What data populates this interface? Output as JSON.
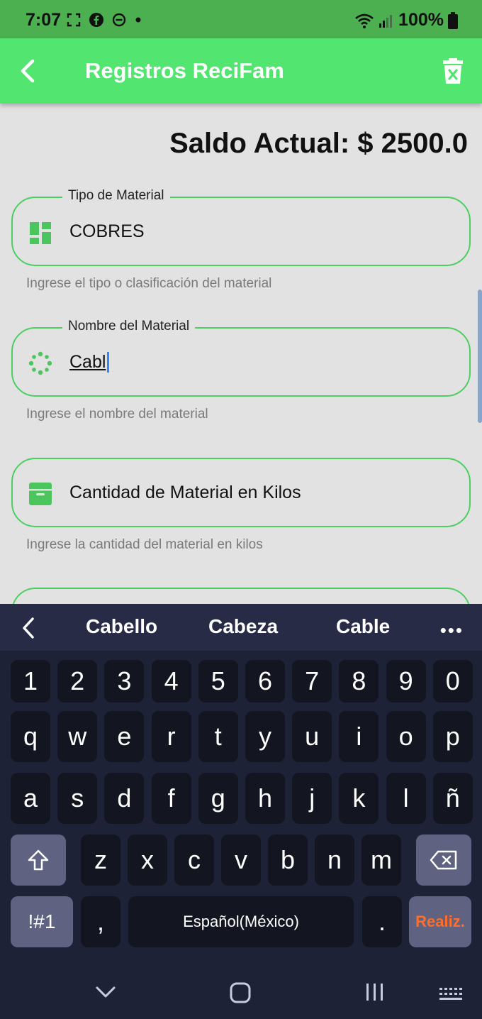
{
  "status_bar": {
    "time": "7:07",
    "battery": "100%",
    "icons": [
      "screenshot-icon",
      "facebook-icon",
      "dnd-icon",
      "dot-icon",
      "wifi-icon",
      "signal-icon",
      "battery-icon"
    ]
  },
  "app_bar": {
    "title": "Registros ReciFam",
    "back_icon": "arrow-back-icon",
    "action_icon": "delete-icon"
  },
  "balance": "Saldo Actual: $ 2500.0",
  "fields": [
    {
      "label": "Tipo de Material",
      "value": "COBRES",
      "placeholder": "",
      "helper": "Ingrese el tipo o clasificación del material",
      "icon": "dashboard-icon"
    },
    {
      "label": "Nombre del Material",
      "value": "Cabl",
      "placeholder": "",
      "helper": "Ingrese el nombre del material",
      "icon": "spinner-icon"
    },
    {
      "label": "",
      "value": "",
      "placeholder": "Cantidad de Material en Kilos",
      "helper": "Ingrese la cantidad del material en kilos",
      "icon": "archive-icon"
    }
  ],
  "keyboard": {
    "suggestions": [
      "Cabello",
      "Cabeza",
      "Cable"
    ],
    "more": "•••",
    "row_numbers": [
      "1",
      "2",
      "3",
      "4",
      "5",
      "6",
      "7",
      "8",
      "9",
      "0"
    ],
    "row1": [
      "q",
      "w",
      "e",
      "r",
      "t",
      "y",
      "u",
      "i",
      "o",
      "p"
    ],
    "row2": [
      "a",
      "s",
      "d",
      "f",
      "g",
      "h",
      "j",
      "k",
      "l",
      "ñ"
    ],
    "row3": [
      "z",
      "x",
      "c",
      "v",
      "b",
      "n",
      "m"
    ],
    "symbols_key": "!#1",
    "comma_key": ",",
    "space_key": "Español(México)",
    "period_key": ".",
    "done_key": "Realiz.",
    "accent_color": "#ff6d2a"
  },
  "colors": {
    "status_bar": "#4caf50",
    "app_bar": "#52e56f",
    "field_border": "#4ccf60",
    "icon_green": "#4cc55e",
    "background": "#e2e2e2",
    "keyboard_bg": "#1e2236"
  }
}
